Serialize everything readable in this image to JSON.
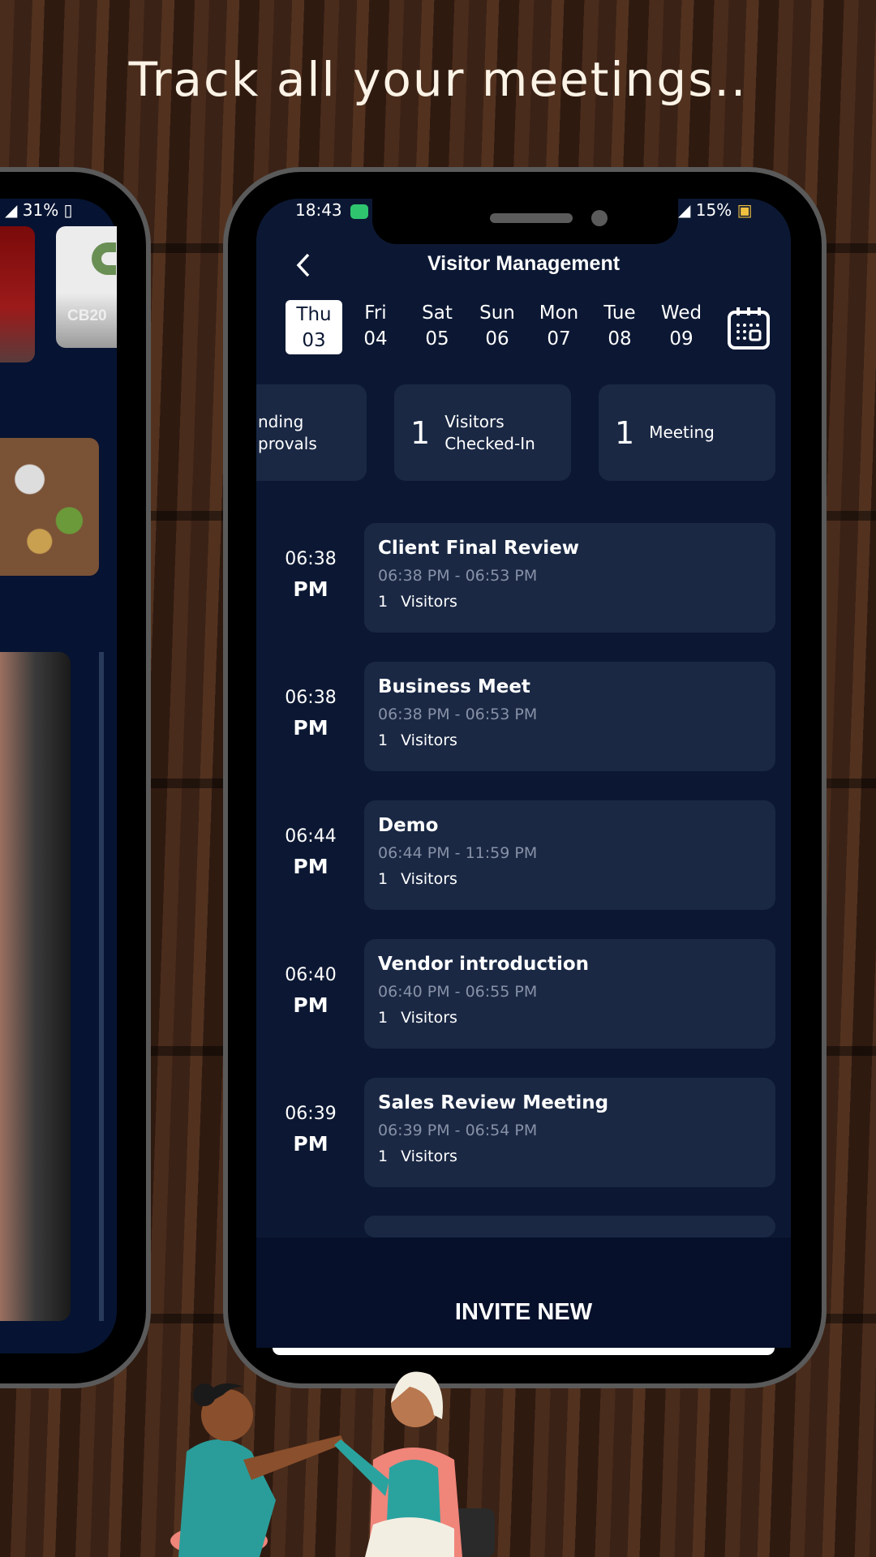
{
  "headline": "Track all your meetings..",
  "left_phone": {
    "battery": "31%",
    "card_label": "CB20"
  },
  "status_bar": {
    "time": "18:43",
    "battery": "15%"
  },
  "header": {
    "title": "Visitor Management",
    "back_icon": "chevron-left-icon",
    "calendar_icon": "calendar-icon"
  },
  "days": [
    {
      "name": "Thu",
      "date": "03",
      "selected": true
    },
    {
      "name": "Fri",
      "date": "04"
    },
    {
      "name": "Sat",
      "date": "05"
    },
    {
      "name": "Sun",
      "date": "06"
    },
    {
      "name": "Mon",
      "date": "07"
    },
    {
      "name": "Tue",
      "date": "08"
    },
    {
      "name": "Wed",
      "date": "09"
    }
  ],
  "stats": [
    {
      "line1": "nding",
      "line2": "provals"
    },
    {
      "count": "1",
      "line1": "Visitors",
      "line2": "Checked-In"
    },
    {
      "count": "1",
      "line1": "Meeting"
    }
  ],
  "meetings": [
    {
      "time": "06:38",
      "ampm": "PM",
      "title": "Client Final Review",
      "range": "06:38 PM - 06:53 PM",
      "visitors": "1",
      "visitors_label": "Visitors"
    },
    {
      "time": "06:38",
      "ampm": "PM",
      "title": "Business Meet",
      "range": "06:38 PM - 06:53 PM",
      "visitors": "1",
      "visitors_label": "Visitors"
    },
    {
      "time": "06:44",
      "ampm": "PM",
      "title": "Demo",
      "range": "06:44 PM - 11:59 PM",
      "visitors": "1",
      "visitors_label": "Visitors"
    },
    {
      "time": "06:40",
      "ampm": "PM",
      "title": "Vendor introduction",
      "range": "06:40 PM - 06:55 PM",
      "visitors": "1",
      "visitors_label": "Visitors"
    },
    {
      "time": "06:39",
      "ampm": "PM",
      "title": "Sales Review Meeting",
      "range": "06:39 PM - 06:54 PM",
      "visitors": "1",
      "visitors_label": "Visitors"
    }
  ],
  "invite_label": "INVITE NEW",
  "colors": {
    "screen_bg": "#0c1833",
    "card_bg": "#1a2844",
    "bottom_bar": "#06102a",
    "headline": "#fbf3e6"
  }
}
